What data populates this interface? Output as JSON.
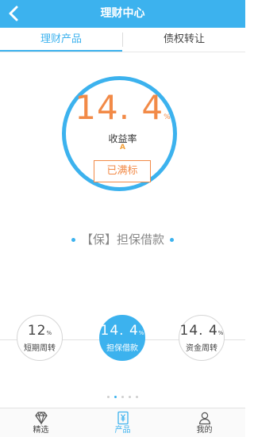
{
  "header": {
    "title": "理财中心",
    "back_icon": "chevron-left-icon"
  },
  "tabs": [
    {
      "label": "理财产品",
      "active": true
    },
    {
      "label": "债权转让",
      "active": false
    }
  ],
  "featured": {
    "rate_value": "14. 4",
    "rate_unit": "%",
    "rate_label": "收益率",
    "grade": "A",
    "status_label": "已满标",
    "product_name": "【保】担保借款"
  },
  "carousel": [
    {
      "rate_value": "12",
      "rate_unit": "%",
      "label": "短期周转",
      "selected": false
    },
    {
      "rate_value": "14. 4",
      "rate_unit": "%",
      "label": "担保借款",
      "selected": true
    },
    {
      "rate_value": "14. 4",
      "rate_unit": "%",
      "label": "资金周转",
      "selected": false
    }
  ],
  "pager": {
    "count": 5,
    "active_index": 1
  },
  "bottom_nav": [
    {
      "label": "精选",
      "icon": "diamond-icon",
      "active": false
    },
    {
      "label": "产品",
      "icon": "yuan-document-icon",
      "active": true
    },
    {
      "label": "我的",
      "icon": "user-icon",
      "active": false
    }
  ],
  "colors": {
    "brand_blue": "#3cb2ee",
    "rate_orange": "#f28a47",
    "grade_orange": "#f4a23c"
  }
}
